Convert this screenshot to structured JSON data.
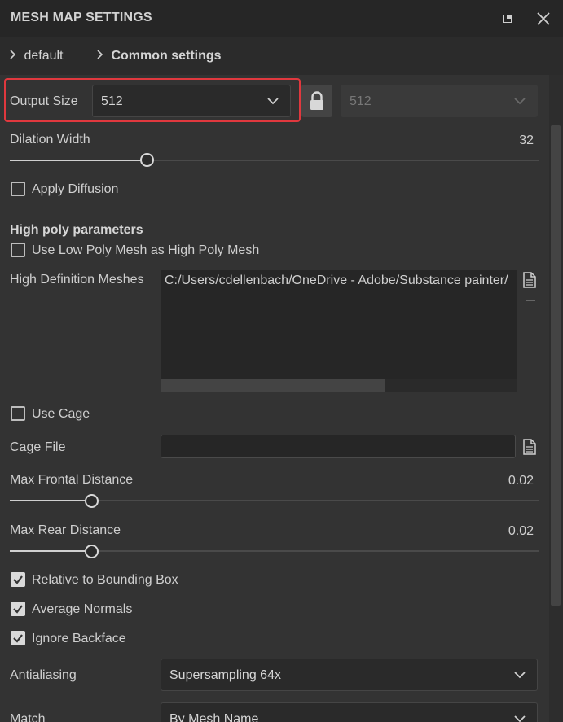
{
  "window": {
    "title": "MESH MAP SETTINGS",
    "float_icon": "float-window-icon",
    "close_icon": "close-icon"
  },
  "breadcrumb": {
    "items": [
      "default",
      "Common settings"
    ]
  },
  "output_size": {
    "label": "Output Size",
    "value": "512",
    "linked_value": "512",
    "highlight_color": "#e0383e"
  },
  "dilation": {
    "label": "Dilation Width",
    "value": "32"
  },
  "apply_diffusion": {
    "label": "Apply Diffusion",
    "checked": false
  },
  "high_poly": {
    "title": "High poly parameters",
    "use_low_poly": {
      "label": "Use Low Poly Mesh as High Poly Mesh",
      "checked": false
    },
    "meshes_label": "High Definition Meshes",
    "mesh_path": "C:/Users/cdellenbach/OneDrive - Adobe/Substance painter/"
  },
  "use_cage": {
    "label": "Use Cage",
    "checked": false
  },
  "cage_file": {
    "label": "Cage File",
    "value": ""
  },
  "max_frontal": {
    "label": "Max Frontal Distance",
    "value": "0.02"
  },
  "max_rear": {
    "label": "Max Rear Distance",
    "value": "0.02"
  },
  "relative_bbox": {
    "label": "Relative to Bounding Box",
    "checked": true
  },
  "average_normals": {
    "label": "Average Normals",
    "checked": true
  },
  "ignore_backface": {
    "label": "Ignore Backface",
    "checked": true
  },
  "antialiasing": {
    "label": "Antialiasing",
    "value": "Supersampling 64x"
  },
  "match": {
    "label": "Match",
    "value": "By Mesh Name"
  }
}
